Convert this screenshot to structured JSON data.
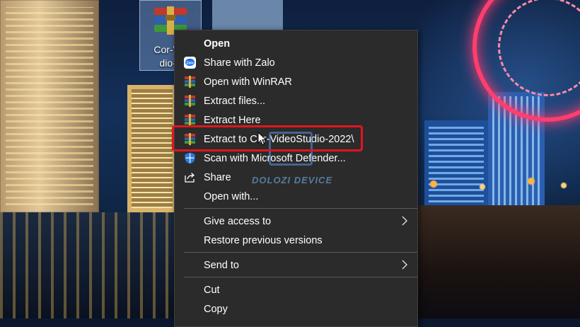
{
  "desktop": {
    "icon_label": "Cor-Vid\ndio-2",
    "icon": "winrar-archive-icon"
  },
  "context_menu": {
    "items": [
      {
        "label": "Open",
        "icon": "",
        "bold": true
      },
      {
        "label": "Share with Zalo",
        "icon": "zalo-icon"
      },
      {
        "label": "Open with WinRAR",
        "icon": "winrar-icon"
      },
      {
        "label": "Extract files...",
        "icon": "winrar-icon"
      },
      {
        "label": "Extract Here",
        "icon": "winrar-icon"
      },
      {
        "label": "Extract to Cor-VideoStudio-2022\\",
        "icon": "winrar-icon",
        "highlighted": true
      },
      {
        "label": "Scan with Microsoft Defender...",
        "icon": "defender-shield-icon"
      },
      {
        "label": "Share",
        "icon": "share-icon"
      },
      {
        "label": "Open with...",
        "icon": ""
      },
      {
        "label": "Give access to",
        "icon": "",
        "submenu": true
      },
      {
        "label": "Restore previous versions",
        "icon": ""
      },
      {
        "label": "Send to",
        "icon": "",
        "submenu": true
      },
      {
        "label": "Cut",
        "icon": ""
      },
      {
        "label": "Copy",
        "icon": ""
      }
    ]
  },
  "annotation": {
    "highlight_color": "#e3141e",
    "cursor": "mouse-pointer-icon"
  },
  "watermark": {
    "text": "DOLOZI DEVICE"
  }
}
